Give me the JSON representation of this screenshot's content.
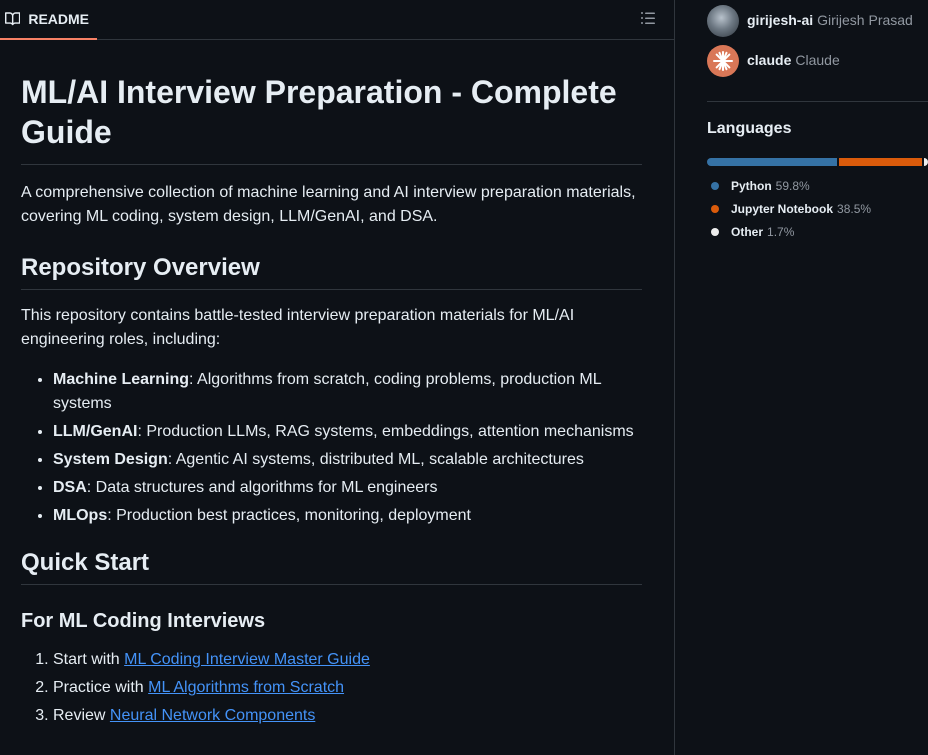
{
  "readme": {
    "tab_label": "README",
    "title": "ML/AI Interview Preparation - Complete Guide",
    "intro": "A comprehensive collection of machine learning and AI interview preparation materials, covering ML coding, system design, LLM/GenAI, and DSA.",
    "overview_heading": "Repository Overview",
    "overview_text": "This repository contains battle-tested interview preparation materials for ML/AI engineering roles, including:",
    "overview_items": [
      {
        "term": "Machine Learning",
        "desc": ": Algorithms from scratch, coding problems, production ML systems"
      },
      {
        "term": "LLM/GenAI",
        "desc": ": Production LLMs, RAG systems, embeddings, attention mechanisms"
      },
      {
        "term": "System Design",
        "desc": ": Agentic AI systems, distributed ML, scalable architectures"
      },
      {
        "term": "DSA",
        "desc": ": Data structures and algorithms for ML engineers"
      },
      {
        "term": "MLOps",
        "desc": ": Production best practices, monitoring, deployment"
      }
    ],
    "quickstart_heading": "Quick Start",
    "coding_heading": "For ML Coding Interviews",
    "steps": [
      {
        "prefix": "Start with ",
        "link": "ML Coding Interview Master Guide"
      },
      {
        "prefix": "Practice with ",
        "link": "ML Algorithms from Scratch"
      },
      {
        "prefix": "Review ",
        "link": "Neural Network Components"
      }
    ]
  },
  "contributors": [
    {
      "login": "girijesh-ai",
      "name": "Girijesh Prasad"
    },
    {
      "login": "claude",
      "name": "Claude"
    }
  ],
  "languages": {
    "title": "Languages",
    "items": [
      {
        "name": "Python",
        "percent": "59.8%",
        "value": 59.8,
        "color": "#3572A5"
      },
      {
        "name": "Jupyter Notebook",
        "percent": "38.5%",
        "value": 38.5,
        "color": "#DA5B0B"
      },
      {
        "name": "Other",
        "percent": "1.7%",
        "value": 1.7,
        "color": "#ededed"
      }
    ]
  },
  "colors": {
    "accent": "#f78166",
    "link": "#4493f8",
    "background": "#0d1117",
    "border": "#30363d"
  }
}
